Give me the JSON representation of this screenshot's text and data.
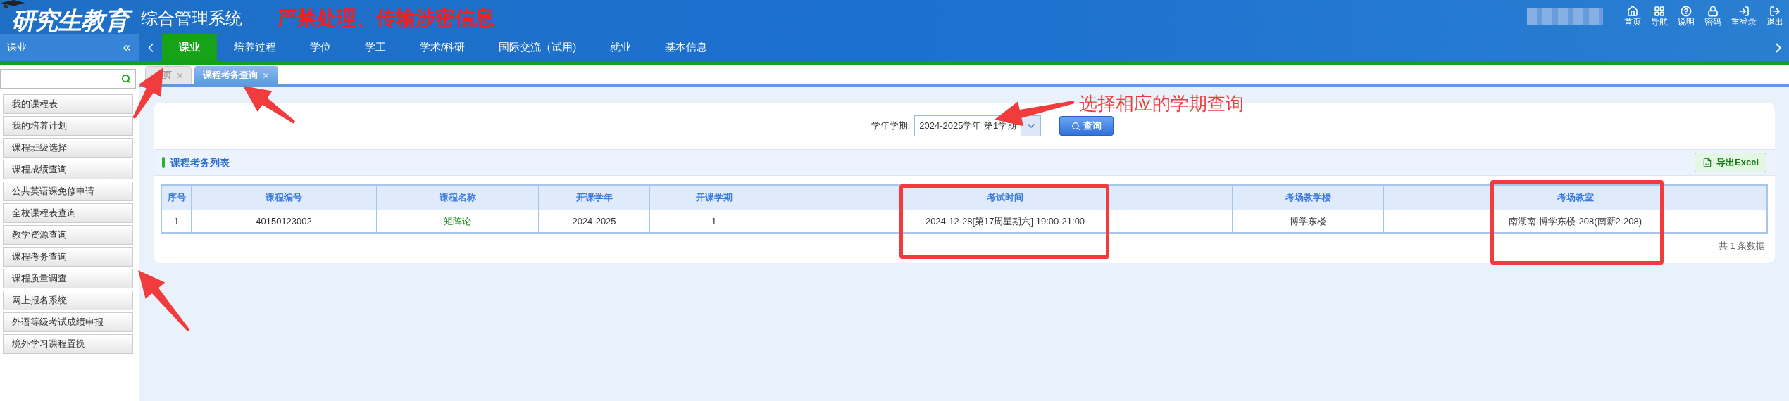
{
  "header": {
    "logo_title": "研究生教育",
    "subtitle": "综合管理系统",
    "warning": "严禁处理、传输涉密信息",
    "toolbar": [
      {
        "label": "首页"
      },
      {
        "label": "导航"
      },
      {
        "label": "说明"
      },
      {
        "label": "密码"
      },
      {
        "label": "重登录"
      },
      {
        "label": "退出"
      }
    ]
  },
  "nav": {
    "section_title": "课业",
    "items": [
      {
        "label": "课业",
        "selected": true
      },
      {
        "label": "培养过程",
        "selected": false
      },
      {
        "label": "学位",
        "selected": false
      },
      {
        "label": "学工",
        "selected": false
      },
      {
        "label": "学术/科研",
        "selected": false
      },
      {
        "label": "国际交流（试用)",
        "selected": false
      },
      {
        "label": "就业",
        "selected": false
      },
      {
        "label": "基本信息",
        "selected": false
      }
    ]
  },
  "sidebar": {
    "items": [
      {
        "label": "我的课程表"
      },
      {
        "label": "我的培养计划"
      },
      {
        "label": "课程班级选择"
      },
      {
        "label": "课程成绩查询"
      },
      {
        "label": "公共英语课免修申请"
      },
      {
        "label": "全校课程表查询"
      },
      {
        "label": "教学资源查询"
      },
      {
        "label": "课程考务查询"
      },
      {
        "label": "课程质量调查"
      },
      {
        "label": "网上报名系统"
      },
      {
        "label": "外语等级考试成绩申报"
      },
      {
        "label": "境外学习课程置换"
      }
    ]
  },
  "tabs": [
    {
      "label": "页",
      "selected": false
    },
    {
      "label": "课程考务查询",
      "selected": true
    }
  ],
  "filter": {
    "label": "学年学期:",
    "value": "2024-2025学年 第1学期",
    "button": "查询"
  },
  "list": {
    "title": "课程考务列表",
    "export_button": "导出Excel",
    "columns": [
      {
        "label": "序号",
        "kind": "text"
      },
      {
        "label": "课程编号",
        "kind": "text"
      },
      {
        "label": "课程名称",
        "kind": "link"
      },
      {
        "label": "开课学年",
        "kind": "text"
      },
      {
        "label": "开课学期",
        "kind": "text"
      },
      {
        "label": "考试时间",
        "kind": "text"
      },
      {
        "label": "考场教学楼",
        "kind": "text"
      },
      {
        "label": "考场教室",
        "kind": "text"
      }
    ],
    "rows": [
      [
        "1",
        "40150123002",
        "矩阵论",
        "2024-2025",
        "1",
        "2024-12-28[第17周星期六] 19:00-21:00",
        "博学东楼",
        "南湖南-博学东楼-208(南新2-208)"
      ]
    ],
    "footer": "共 1 条数据"
  },
  "annotation": {
    "note": "选择相应的学期查询"
  }
}
